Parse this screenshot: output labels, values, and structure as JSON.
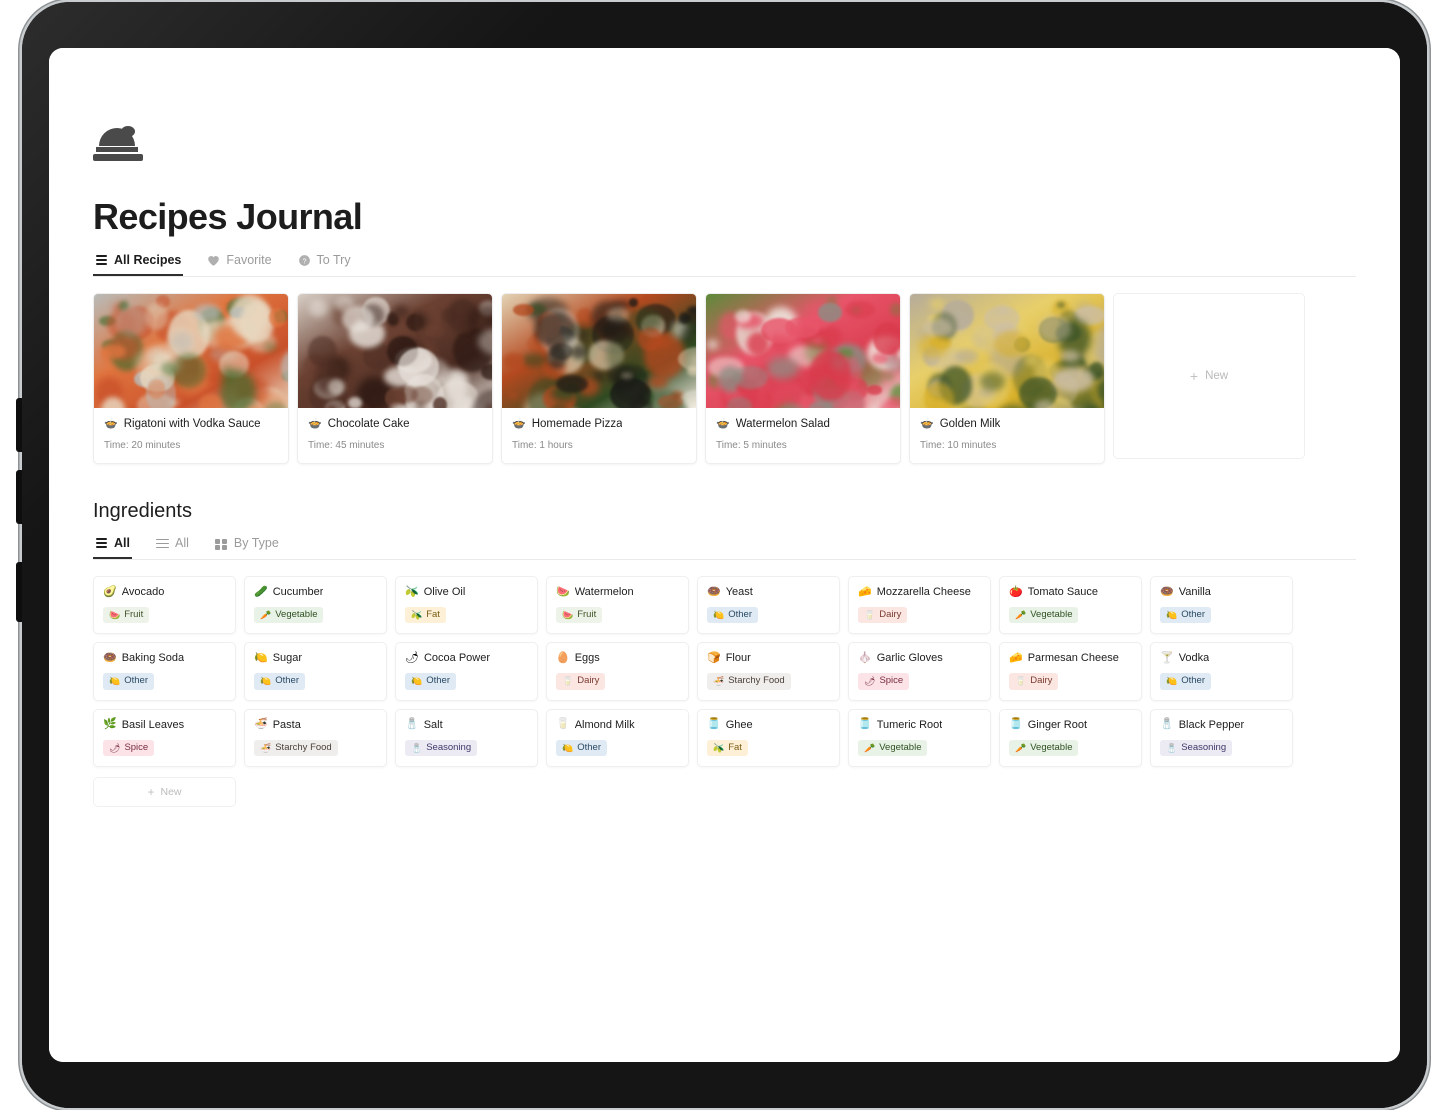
{
  "app": {
    "page_title": "Recipes Journal",
    "page_icon": "covered-dish-icon"
  },
  "recipe_tabs": [
    {
      "label": "All Recipes",
      "icon": "layers-icon",
      "active": true
    },
    {
      "label": "Favorite",
      "icon": "heart-icon",
      "active": false
    },
    {
      "label": "To Try",
      "icon": "question-circle-icon",
      "active": false
    }
  ],
  "recipes": {
    "new_label": "New",
    "items": [
      {
        "title": "Rigatoni with Vodka Sauce",
        "emoji": "🍲",
        "time": "Time: 20 minutes",
        "image": "rigatoni-pasta-photo",
        "colors": [
          "#c9502a",
          "#e0753f",
          "#b8bcb9",
          "#3f6b2e",
          "#e8d8c0"
        ]
      },
      {
        "title": "Chocolate Cake",
        "emoji": "🍲",
        "time": "Time: 45 minutes",
        "image": "chocolate-cake-photo",
        "colors": [
          "#4b2c22",
          "#6b4132",
          "#d8cfc6",
          "#2b1812",
          "#e9e3dc"
        ]
      },
      {
        "title": "Homemade Pizza",
        "emoji": "🍲",
        "time": "Time: 1 hours",
        "image": "homemade-pizza-photo",
        "colors": [
          "#2f4a22",
          "#b4491f",
          "#e3d4b6",
          "#1a1a16",
          "#f2ece0"
        ]
      },
      {
        "title": "Watermelon Salad",
        "emoji": "🍲",
        "time": "Time: 5 minutes",
        "image": "watermelon-salad-photo",
        "colors": [
          "#d93b4c",
          "#e8556a",
          "#5d8b3a",
          "#8b8e84",
          "#f0eee6"
        ]
      },
      {
        "title": "Golden Milk",
        "emoji": "🍲",
        "time": "Time: 10 minutes",
        "image": "golden-milk-photo",
        "colors": [
          "#d8b02a",
          "#e8cf6a",
          "#b6ac9a",
          "#cdbfa6",
          "#3c5428"
        ]
      }
    ]
  },
  "ingredients_section": {
    "title": "Ingredients",
    "new_label": "New",
    "tabs": [
      {
        "label": "All",
        "icon": "layers-icon",
        "active": true
      },
      {
        "label": "All",
        "icon": "list-icon",
        "active": false
      },
      {
        "label": "By Type",
        "icon": "grid-icon",
        "active": false
      }
    ]
  },
  "tag_styles": {
    "Fruit": {
      "bg": "#eef3e9",
      "fg": "#3d5229",
      "emoji": "🍉"
    },
    "Vegetable": {
      "bg": "#e9f2e6",
      "fg": "#2f5124",
      "emoji": "🥕"
    },
    "Fat": {
      "bg": "#fdf0d6",
      "fg": "#7a5a12",
      "emoji": "🫒"
    },
    "Other": {
      "bg": "#dfeaf4",
      "fg": "#2b4a63",
      "emoji": "🍋"
    },
    "Dairy": {
      "bg": "#fbe6e2",
      "fg": "#7a3b30",
      "emoji": "🥛"
    },
    "Starchy Food": {
      "bg": "#f0eeec",
      "fg": "#4a3f38",
      "emoji": "🍜"
    },
    "Spice": {
      "bg": "#fbe3e8",
      "fg": "#7a2c3e",
      "emoji": "🌶"
    },
    "Seasoning": {
      "bg": "#eceaf3",
      "fg": "#40386a",
      "emoji": "🧂"
    }
  },
  "ingredients": [
    {
      "name": "Avocado",
      "emoji": "🥑",
      "tag": "Fruit"
    },
    {
      "name": "Cucumber",
      "emoji": "🥒",
      "tag": "Vegetable"
    },
    {
      "name": "Olive Oil",
      "emoji": "🫒",
      "tag": "Fat"
    },
    {
      "name": "Watermelon",
      "emoji": "🍉",
      "tag": "Fruit"
    },
    {
      "name": "Yeast",
      "emoji": "🍩",
      "tag": "Other"
    },
    {
      "name": "Mozzarella Cheese",
      "emoji": "🧀",
      "tag": "Dairy"
    },
    {
      "name": "Tomato Sauce",
      "emoji": "🍅",
      "tag": "Vegetable"
    },
    {
      "name": "Vanilla",
      "emoji": "🍩",
      "tag": "Other"
    },
    {
      "name": "Baking Soda",
      "emoji": "🍩",
      "tag": "Other"
    },
    {
      "name": "Sugar",
      "emoji": "🍋",
      "tag": "Other"
    },
    {
      "name": "Cocoa Power",
      "emoji": "🌶",
      "tag": "Other"
    },
    {
      "name": "Eggs",
      "emoji": "🥚",
      "tag": "Dairy"
    },
    {
      "name": "Flour",
      "emoji": "🍞",
      "tag": "Starchy Food"
    },
    {
      "name": "Garlic Gloves",
      "emoji": "🧄",
      "tag": "Spice"
    },
    {
      "name": "Parmesan Cheese",
      "emoji": "🧀",
      "tag": "Dairy"
    },
    {
      "name": "Vodka",
      "emoji": "🍸",
      "tag": "Other"
    },
    {
      "name": "Basil Leaves",
      "emoji": "🌿",
      "tag": "Spice"
    },
    {
      "name": "Pasta",
      "emoji": "🍜",
      "tag": "Starchy Food"
    },
    {
      "name": "Salt",
      "emoji": "🧂",
      "tag": "Seasoning"
    },
    {
      "name": "Almond Milk",
      "emoji": "🥛",
      "tag": "Other"
    },
    {
      "name": "Ghee",
      "emoji": "🫙",
      "tag": "Fat"
    },
    {
      "name": "Tumeric Root",
      "emoji": "🫙",
      "tag": "Vegetable"
    },
    {
      "name": "Ginger Root",
      "emoji": "🫙",
      "tag": "Vegetable"
    },
    {
      "name": "Black Pepper",
      "emoji": "🧂",
      "tag": "Seasoning"
    }
  ]
}
